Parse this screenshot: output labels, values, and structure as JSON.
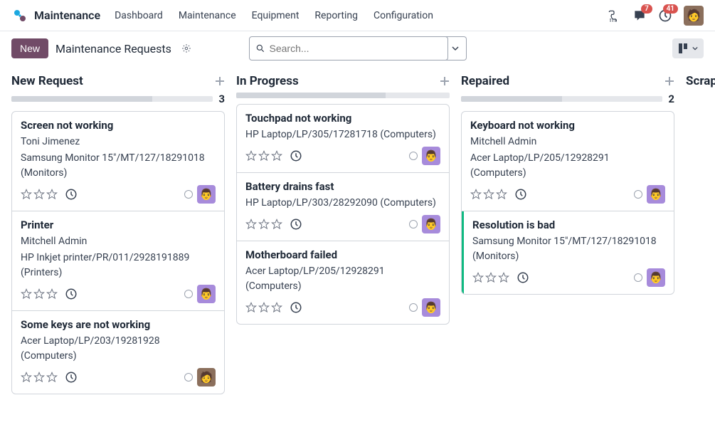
{
  "app_name": "Maintenance",
  "nav": {
    "links": [
      "Dashboard",
      "Maintenance",
      "Equipment",
      "Reporting",
      "Configuration"
    ],
    "chat_badge": "7",
    "activity_badge": "41"
  },
  "controlbar": {
    "new_label": "New",
    "breadcrumb": "Maintenance Requests",
    "search_placeholder": "Search..."
  },
  "columns": [
    {
      "title": "New Request",
      "count": "3",
      "barFill": "70",
      "cards": [
        {
          "title": "Screen not working",
          "person": "Toni Jimenez",
          "equipment": "Samsung Monitor 15\"/MT/127/18291018 (Monitors)",
          "avatar": "purple"
        },
        {
          "title": "Printer",
          "person": "Mitchell Admin",
          "equipment": "HP Inkjet printer/PR/011/2928191889 (Printers)",
          "avatar": "purple"
        },
        {
          "title": "Some keys are not working",
          "person": "",
          "equipment": "Acer Laptop/LP/203/19281928 (Computers)",
          "avatar": "brown"
        }
      ]
    },
    {
      "title": "In Progress",
      "count": "",
      "barFill": "70",
      "cards": [
        {
          "title": "Touchpad not working",
          "person": "",
          "equipment": "HP Laptop/LP/305/17281718 (Computers)",
          "avatar": "purple"
        },
        {
          "title": "Battery drains fast",
          "person": "",
          "equipment": "HP Laptop/LP/303/28292090 (Computers)",
          "avatar": "purple"
        },
        {
          "title": "Motherboard failed",
          "person": "",
          "equipment": "Acer Laptop/LP/205/12928291 (Computers)",
          "avatar": "purple"
        }
      ]
    },
    {
      "title": "Repaired",
      "count": "2",
      "barFill": "50",
      "cards": [
        {
          "title": "Keyboard not working",
          "person": "Mitchell Admin",
          "equipment": "Acer Laptop/LP/205/12928291 (Computers)",
          "avatar": "purple"
        },
        {
          "title": "Resolution is bad",
          "person": "",
          "equipment": "Samsung Monitor 15\"/MT/127/18291018 (Monitors)",
          "avatar": "purple",
          "highlighted": true
        }
      ]
    }
  ],
  "scrap_label": "Scrap"
}
